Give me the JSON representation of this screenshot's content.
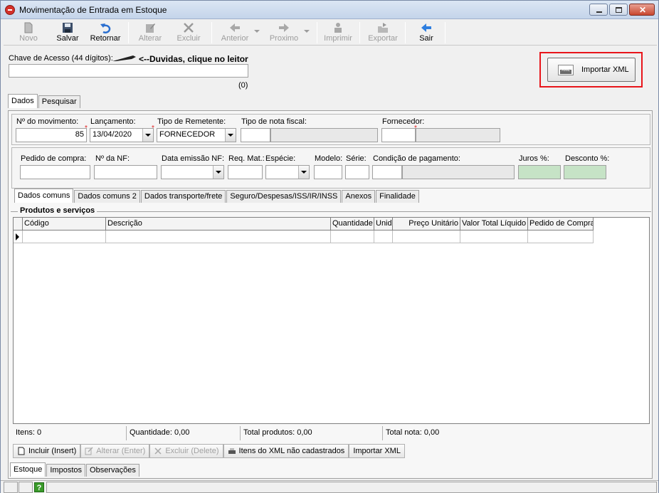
{
  "window": {
    "title": "Movimentação de Entrada em Estoque",
    "close_glyph": "✕"
  },
  "toolbar": {
    "novo": "Novo",
    "salvar": "Salvar",
    "retornar": "Retornar",
    "alterar": "Alterar",
    "excluir": "Excluir",
    "anterior": "Anterior",
    "proximo": "Proximo",
    "imprimir": "Imprimir",
    "exportar": "Exportar",
    "sair": "Sair"
  },
  "chave": {
    "label": "Chave de Acesso (44 dígitos):",
    "hint": "<--Duvidas, clique no leitor",
    "value": "",
    "count": "(0)"
  },
  "importar_xml": {
    "label": "Importar XML",
    "icon_text": "XML"
  },
  "top_tabs": [
    "Dados",
    "Pesquisar"
  ],
  "form": {
    "movimento_label": "Nº do movimento:",
    "movimento_value": "85",
    "lancamento_label": "Lançamento:",
    "lancamento_value": "13/04/2020",
    "tipo_remetente_label": "Tipo de Remetente:",
    "tipo_remetente_value": "FORNECEDOR",
    "tipo_nota_label": "Tipo de nota fiscal:",
    "fornecedor_label": "Fornecedor:",
    "pedido_label": "Pedido de compra:",
    "nf_label": "Nº da NF:",
    "data_emissao_label": "Data emissão NF:",
    "req_label": "Req. Mat.:",
    "especie_label": "Espécie:",
    "modelo_label": "Modelo:",
    "serie_label": "Série:",
    "condicao_label": "Condição de pagamento:",
    "juros_label": "Juros %:",
    "desconto_label": "Desconto %:"
  },
  "inner_tabs": [
    "Dados comuns",
    "Dados comuns 2",
    "Dados transporte/frete",
    "Seguro/Despesas/ISS/IR/INSS",
    "Anexos",
    "Finalidade"
  ],
  "produtos": {
    "title": "Produtos e serviços",
    "columns": [
      "Código",
      "Descrição",
      "Quantidade",
      "Unid",
      "Preço Unitário",
      "Valor Total Líquido",
      "Pedido de Compra"
    ]
  },
  "status": {
    "itens": "Itens: 0",
    "quantidade": "Quantidade: 0,00",
    "total_produtos": "Total produtos: 0,00",
    "total_nota": "Total nota: 0,00"
  },
  "actions": {
    "incluir": "Incluir (Insert)",
    "alterar": "Alterar (Enter)",
    "excluir": "Excluir (Delete)",
    "itens_xml": "Itens do XML não cadastrados",
    "importar_xml": "Importar XML"
  },
  "bottom_tabs": [
    "Estoque",
    "Impostos",
    "Observações"
  ],
  "help_glyph": "?"
}
